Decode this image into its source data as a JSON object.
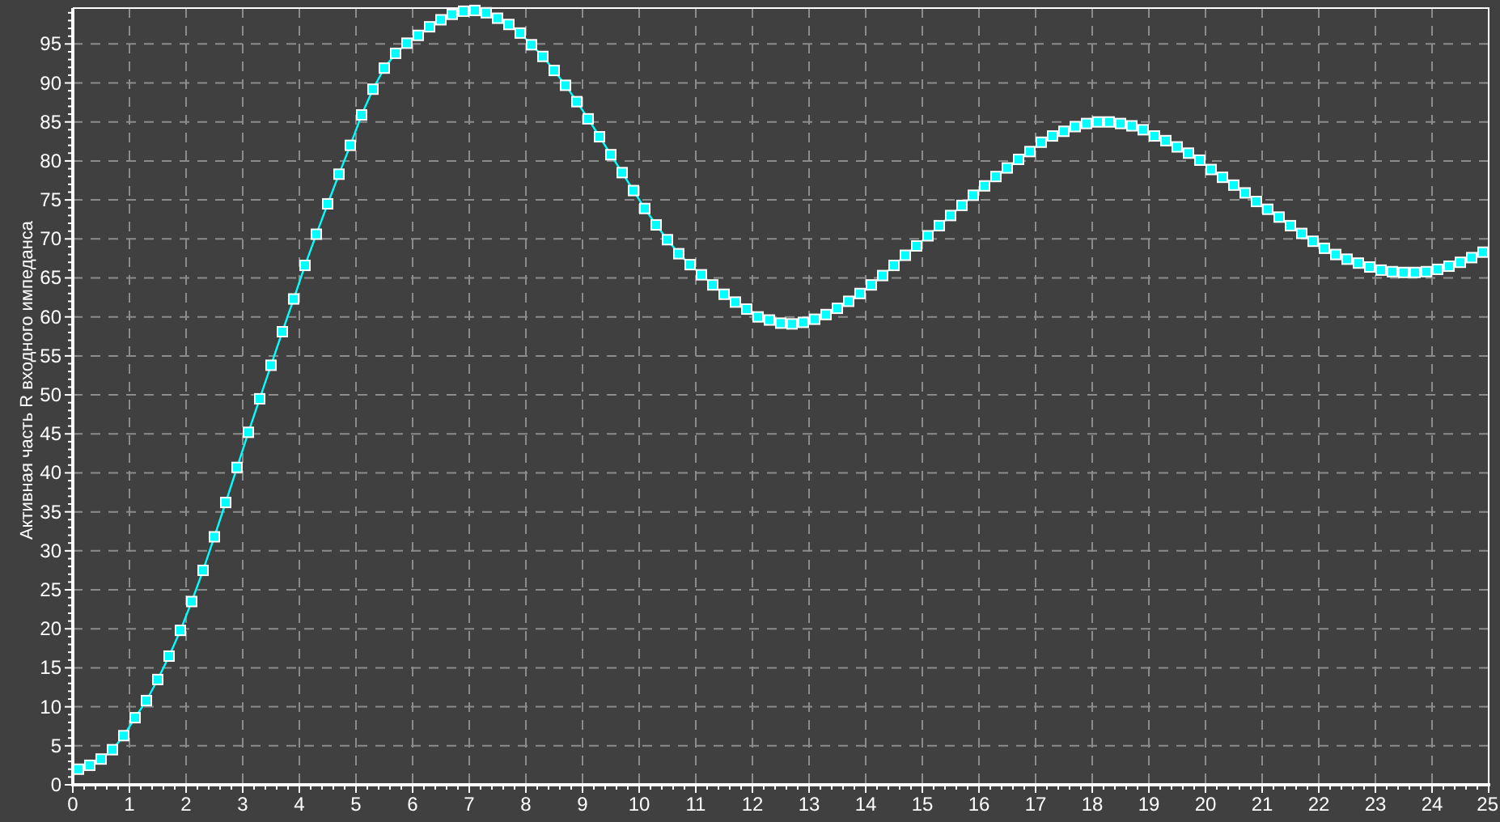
{
  "chart_data": {
    "type": "line",
    "grid": true,
    "ylabel": "Активная часть R входного импеданса",
    "xlim": [
      0,
      25
    ],
    "ylim": [
      0,
      99.6
    ],
    "xticks": [
      0,
      1,
      2,
      3,
      4,
      5,
      6,
      7,
      8,
      9,
      10,
      11,
      12,
      13,
      14,
      15,
      16,
      17,
      18,
      19,
      20,
      21,
      22,
      23,
      24,
      25
    ],
    "yticks": [
      0,
      5,
      10,
      15,
      20,
      25,
      30,
      35,
      40,
      45,
      50,
      55,
      60,
      65,
      70,
      75,
      80,
      85,
      90,
      95
    ],
    "x": [
      0.1,
      0.3,
      0.5,
      0.7,
      0.9,
      1.1,
      1.3,
      1.5,
      1.7,
      1.9,
      2.1,
      2.3,
      2.5,
      2.7,
      2.9,
      3.1,
      3.3,
      3.5,
      3.7,
      3.9,
      4.1,
      4.3,
      4.5,
      4.7,
      4.9,
      5.1,
      5.3,
      5.5,
      5.7,
      5.9,
      6.1,
      6.3,
      6.5,
      6.7,
      6.9,
      7.1,
      7.3,
      7.5,
      7.7,
      7.9,
      8.1,
      8.3,
      8.5,
      8.7,
      8.9,
      9.1,
      9.3,
      9.5,
      9.7,
      9.9,
      10.1,
      10.3,
      10.5,
      10.7,
      10.9,
      11.1,
      11.3,
      11.5,
      11.7,
      11.9,
      12.1,
      12.3,
      12.5,
      12.7,
      12.9,
      13.1,
      13.3,
      13.5,
      13.7,
      13.9,
      14.1,
      14.3,
      14.5,
      14.7,
      14.9,
      15.1,
      15.3,
      15.5,
      15.7,
      15.9,
      16.1,
      16.3,
      16.5,
      16.7,
      16.9,
      17.1,
      17.3,
      17.5,
      17.7,
      17.9,
      18.1,
      18.3,
      18.5,
      18.7,
      18.9,
      19.1,
      19.3,
      19.5,
      19.7,
      19.9,
      20.1,
      20.3,
      20.5,
      20.7,
      20.9,
      21.1,
      21.3,
      21.5,
      21.7,
      21.9,
      22.1,
      22.3,
      22.5,
      22.7,
      22.9,
      23.1,
      23.3,
      23.5,
      23.7,
      23.9,
      24.1,
      24.3,
      24.5,
      24.7,
      24.9
    ],
    "series": [
      {
        "color": "#00ffff",
        "marker": "square",
        "values": [
          2.0,
          2.5,
          3.3,
          4.5,
          6.3,
          8.6,
          10.8,
          13.5,
          16.5,
          19.8,
          23.5,
          27.5,
          31.8,
          36.2,
          40.7,
          45.2,
          49.5,
          53.8,
          58.1,
          62.3,
          66.6,
          70.6,
          74.5,
          78.3,
          82.0,
          85.9,
          89.2,
          91.9,
          93.8,
          95.1,
          96.1,
          97.2,
          98.1,
          98.8,
          99.2,
          99.3,
          99.0,
          98.3,
          97.5,
          96.4,
          94.9,
          93.4,
          91.6,
          89.7,
          87.6,
          85.4,
          83.1,
          80.8,
          78.5,
          76.2,
          73.9,
          71.8,
          69.9,
          68.1,
          66.7,
          65.4,
          64.1,
          62.9,
          61.9,
          61.0,
          60.0,
          59.6,
          59.2,
          59.1,
          59.3,
          59.7,
          60.3,
          61.1,
          62.0,
          63.0,
          64.1,
          65.3,
          66.6,
          67.9,
          69.1,
          70.4,
          71.7,
          73.0,
          74.3,
          75.6,
          76.8,
          78.0,
          79.1,
          80.2,
          81.2,
          82.4,
          83.2,
          83.8,
          84.4,
          84.8,
          85.0,
          85.0,
          84.8,
          84.5,
          84.0,
          83.2,
          82.6,
          81.8,
          81.0,
          80.1,
          78.9,
          77.9,
          76.9,
          75.9,
          74.8,
          73.8,
          72.8,
          71.7,
          70.7,
          69.7,
          68.8,
          68.0,
          67.4,
          66.9,
          66.4,
          66.0,
          65.8,
          65.7,
          65.7,
          65.8,
          66.1,
          66.5,
          67.0,
          67.6,
          68.3
        ]
      }
    ]
  }
}
